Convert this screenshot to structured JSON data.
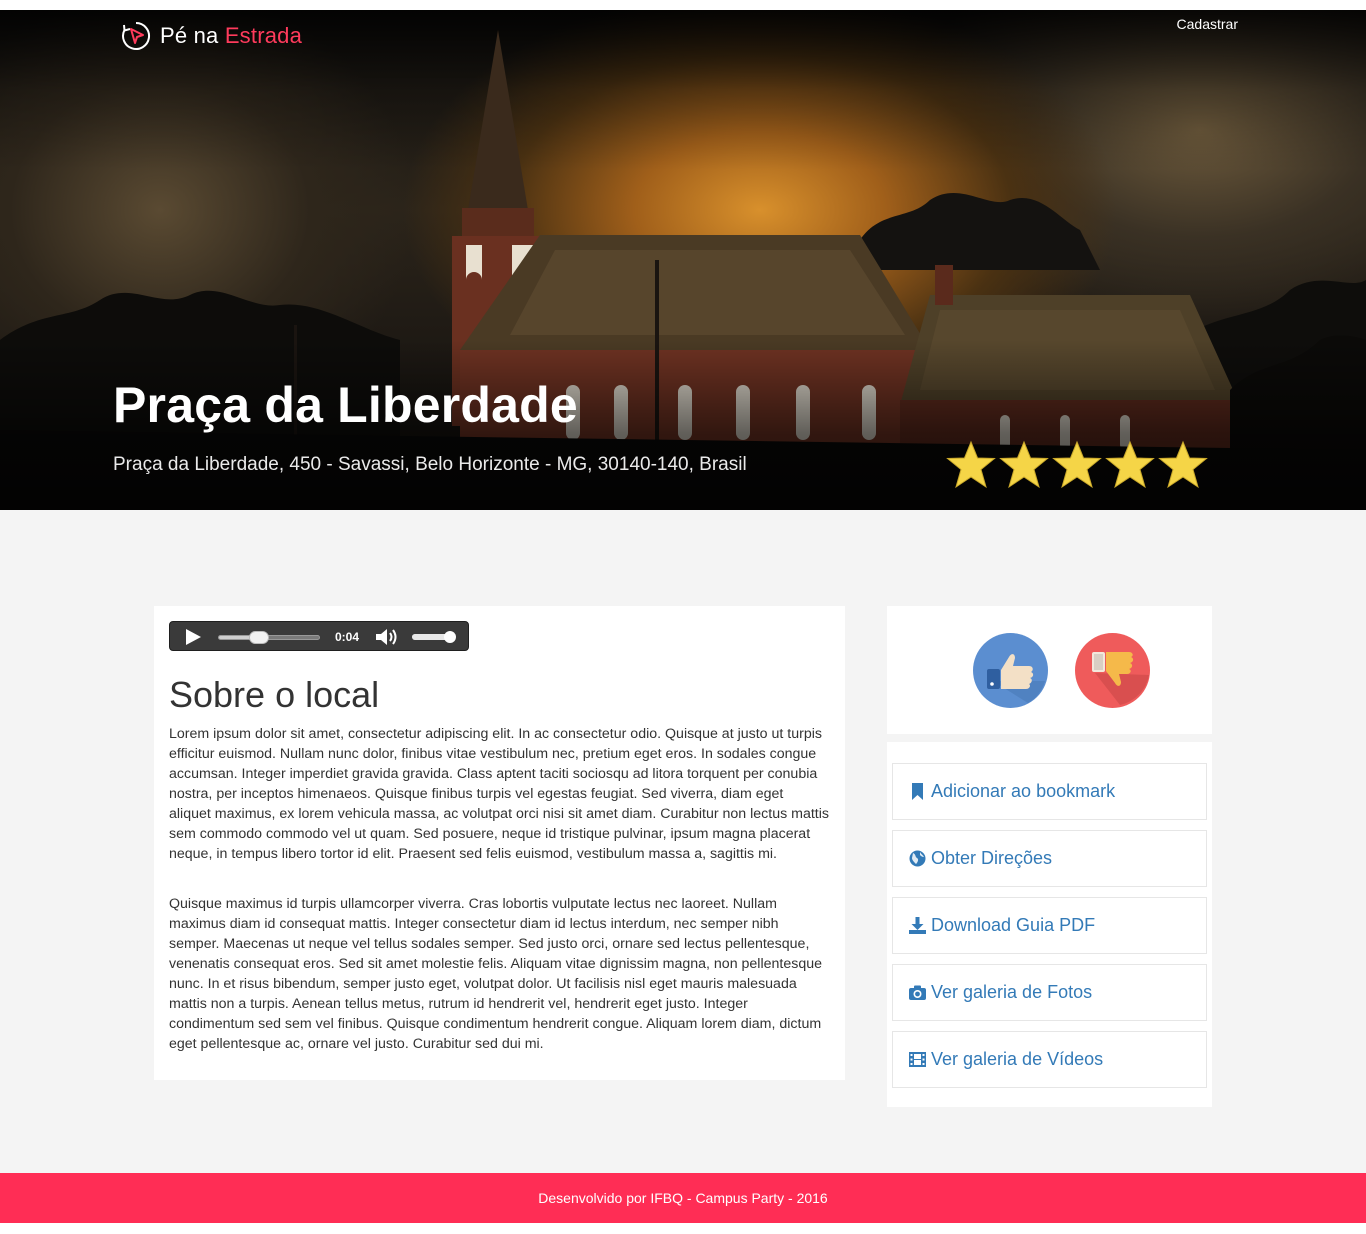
{
  "brand": {
    "name_part1": "Pé na",
    "name_part2": "Estrada",
    "logo_icon": "compass-arrow-icon",
    "accent_color": "#ff3b5c"
  },
  "nav": {
    "register_label": "Cadastrar"
  },
  "place": {
    "title": "Praça da Liberdade",
    "address": "Praça da Liberdade, 450 - Savassi, Belo Horizonte - MG, 30140-140, Brasil",
    "rating": 5,
    "rating_max": 5,
    "star_color": "#f5d547"
  },
  "audio": {
    "time": "0:04",
    "progress": 0.4,
    "volume": 0.9
  },
  "about": {
    "title": "Sobre o local",
    "paragraphs": [
      "Lorem ipsum dolor sit amet, consectetur adipiscing elit. In ac consectetur odio. Quisque at justo ut turpis efficitur euismod. Nullam nunc dolor, finibus vitae vestibulum nec, pretium eget eros. In sodales congue accumsan. Integer imperdiet gravida gravida. Class aptent taciti sociosqu ad litora torquent per conubia nostra, per inceptos himenaeos. Quisque finibus turpis vel egestas feugiat. Sed viverra, diam eget aliquet maximus, ex lorem vehicula massa, ac volutpat orci nisi sit amet diam. Curabitur non lectus mattis sem commodo commodo vel ut quam. Sed posuere, neque id tristique pulvinar, ipsum magna placerat neque, in tempus libero tortor id elit. Praesent sed felis euismod, vestibulum massa a, sagittis mi.",
      "Quisque maximus id turpis ullamcorper viverra. Cras lobortis vulputate lectus nec laoreet. Nullam maximus diam id consequat mattis. Integer consectetur diam id lectus interdum, nec semper nibh semper. Maecenas ut neque vel tellus sodales semper. Sed justo orci, ornare sed lectus pellentesque, venenatis consequat eros. Sed sit amet molestie felis. Aliquam vitae dignissim magna, non pellentesque nunc. In et risus bibendum, semper justo eget, volutpat dolor. Ut facilisis nisl eget mauris malesuada mattis non a turpis. Aenean tellus metus, rutrum id hendrerit vel, hendrerit eget justo. Integer condimentum sed sem vel finibus. Quisque condimentum hendrerit congue. Aliquam lorem diam, dictum eget pellentesque ac, ornare vel justo. Curabitur sed dui mi."
    ]
  },
  "vote": {
    "like_icon": "thumbs-up-icon",
    "dislike_icon": "thumbs-down-icon",
    "like_color": "#5b8ed0",
    "dislike_color": "#ef5b5b"
  },
  "actions": [
    {
      "label": "Adicionar ao bookmark",
      "icon": "bookmark-icon"
    },
    {
      "label": "Obter Direções",
      "icon": "globe-icon"
    },
    {
      "label": "Download Guia PDF",
      "icon": "download-icon"
    },
    {
      "label": "Ver galeria de Fotos",
      "icon": "camera-icon"
    },
    {
      "label": "Ver galeria de Vídeos",
      "icon": "film-icon"
    }
  ],
  "footer": {
    "text": "Desenvolvido por IFBQ - Campus Party - 2016",
    "color": "#ff2d55"
  }
}
